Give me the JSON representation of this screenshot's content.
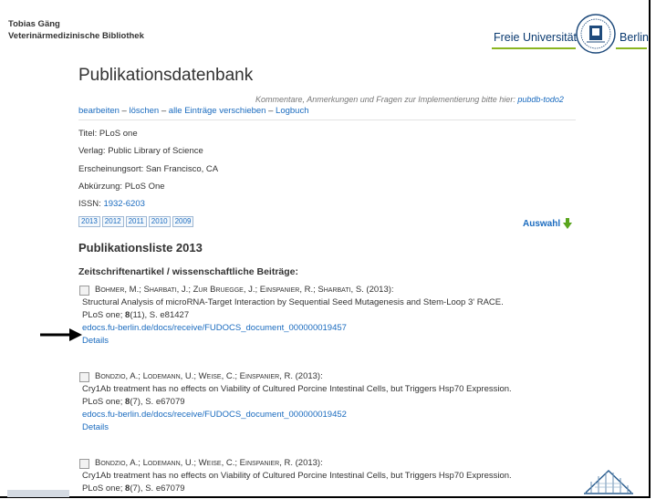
{
  "owner": {
    "name": "Tobias Gäng",
    "dept": "Veterinärmedizinische Bibliothek"
  },
  "logo": {
    "left": "Freie Universität",
    "right": "Berlin"
  },
  "page": {
    "title": "Publikationsdatenbank",
    "comment_text": "Kommentare, Anmerkungen und Fragen zur Implementierung bitte hier:",
    "comment_link": "pubdb-todo2",
    "actions": [
      {
        "label": "bearbeiten"
      },
      {
        "label": "löschen"
      },
      {
        "label": "alle Einträge verschieben"
      },
      {
        "label": "Logbuch"
      }
    ],
    "action_sep": " – "
  },
  "journal": {
    "title": "Titel: PLoS one",
    "publisher": "Verlag: Public Library of Science",
    "place": "Erscheinungsort: San Francisco, CA",
    "abbrev": "Abkürzung: PLoS One",
    "issn_label": "ISSN: ",
    "issn_value": "1932-6203"
  },
  "years": [
    "2013",
    "2012",
    "2011",
    "2010",
    "2009"
  ],
  "auswahl": "Auswahl",
  "list": {
    "title": "Publikationsliste 2013",
    "category": "Zeitschriftenartikel / wissenschaftliche Beiträge:"
  },
  "entries": [
    {
      "authors": "Bohmer, M.; Sharbati, J.; Zur Bruegge, J.; Einspanier, R.; Sharbati, S. (2013):",
      "title": "Structural Analysis of microRNA-Target Interaction by Sequential Seed Mutagenesis and Stem-Loop 3' RACE.",
      "journal_prefix": "PLoS one; ",
      "volume": "8",
      "journal_suffix": "(11), S. e81427",
      "link": "edocs.fu-berlin.de/docs/receive/FUDOCS_document_000000019457",
      "details": "Details"
    },
    {
      "authors": "Bondzio, A.; Lodemann, U.; Weise, C.; Einspanier, R. (2013):",
      "title": "Cry1Ab treatment has no effects on Viability of Cultured Porcine Intestinal Cells, but Triggers Hsp70 Expression.",
      "journal_prefix": "PLoS one; ",
      "volume": "8",
      "journal_suffix": "(7), S. e67079",
      "link": "edocs.fu-berlin.de/docs/receive/FUDOCS_document_000000019452",
      "details": "Details"
    },
    {
      "authors": "Bondzio, A.; Lodemann, U.; Weise, C.; Einspanier, R. (2013):",
      "title": "Cry1Ab treatment has no effects on Viability of Cultured Porcine Intestinal Cells, but Triggers Hsp70 Expression.",
      "journal_prefix": "PLoS one; ",
      "volume": "8",
      "journal_suffix": "(7), S. e67079"
    }
  ],
  "colors": {
    "link": "#1a6bbf",
    "fu_green": "#8ab520",
    "fu_blue": "#0a3a70"
  }
}
